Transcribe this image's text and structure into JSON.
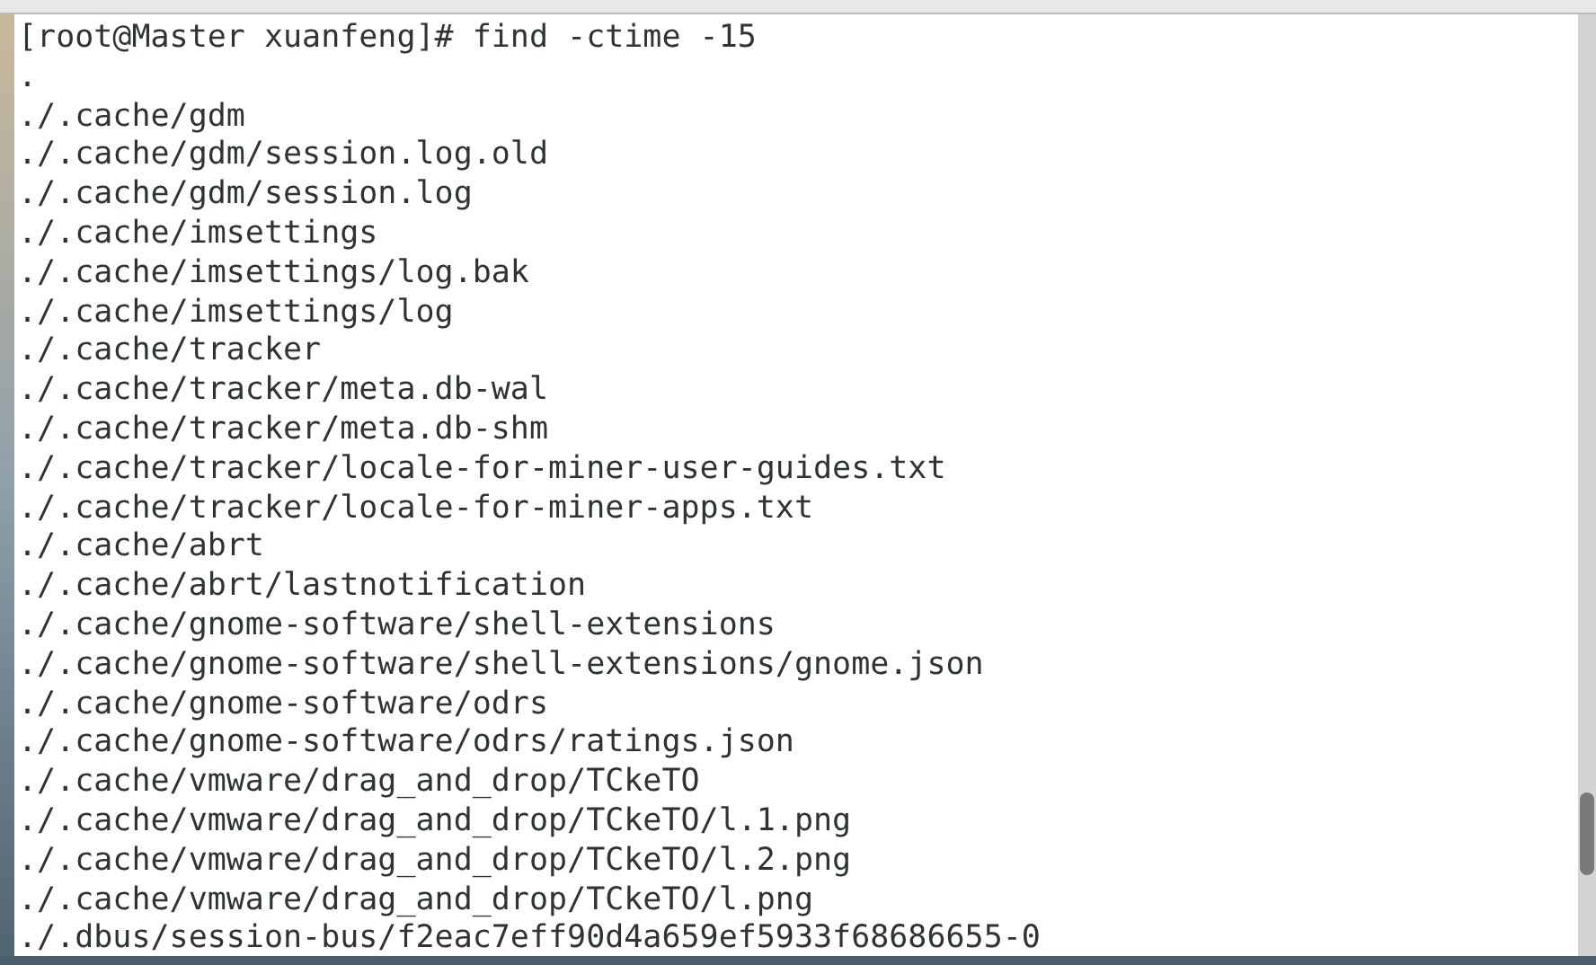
{
  "terminal": {
    "prompt": "[root@Master xuanfeng]# find -ctime -15",
    "output": [
      ".",
      "./.cache/gdm",
      "./.cache/gdm/session.log.old",
      "./.cache/gdm/session.log",
      "./.cache/imsettings",
      "./.cache/imsettings/log.bak",
      "./.cache/imsettings/log",
      "./.cache/tracker",
      "./.cache/tracker/meta.db-wal",
      "./.cache/tracker/meta.db-shm",
      "./.cache/tracker/locale-for-miner-user-guides.txt",
      "./.cache/tracker/locale-for-miner-apps.txt",
      "./.cache/abrt",
      "./.cache/abrt/lastnotification",
      "./.cache/gnome-software/shell-extensions",
      "./.cache/gnome-software/shell-extensions/gnome.json",
      "./.cache/gnome-software/odrs",
      "./.cache/gnome-software/odrs/ratings.json",
      "./.cache/vmware/drag_and_drop/TCkeTO",
      "./.cache/vmware/drag_and_drop/TCkeTO/l.1.png",
      "./.cache/vmware/drag_and_drop/TCkeTO/l.2.png",
      "./.cache/vmware/drag_and_drop/TCkeTO/l.png",
      "./.dbus/session-bus/f2eac7eff90d4a659ef5933f68686655-0"
    ]
  }
}
